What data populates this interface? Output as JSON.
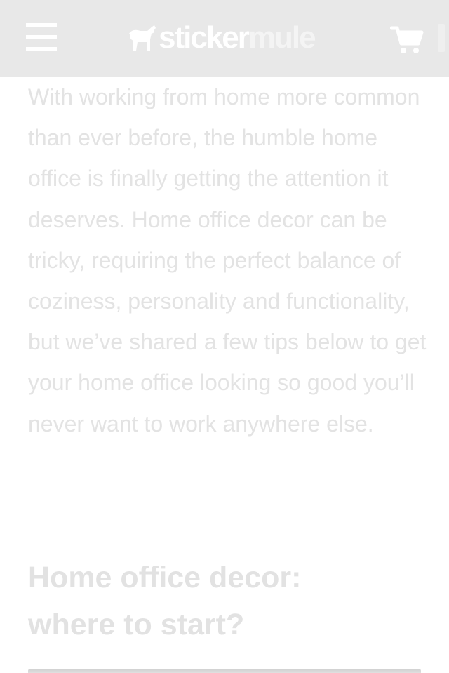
{
  "header": {
    "logo": {
      "part1": "sticker",
      "part2": "mule",
      "icon": "horse-logo-icon"
    },
    "menu_icon": "hamburger-menu-icon",
    "cart_icon": "shopping-cart-icon"
  },
  "article": {
    "intro": "With working from home more common than ever before, the humble home office is finally getting the attention it deserves. Home office decor can be tricky, requiring the perfect balance of coziness, personality and functionality, but we’ve shared a few tips below to get your home office looking so good you’ll never want to work anywhere else.",
    "heading": "Home office decor: where to start?"
  },
  "colors": {
    "header_bg": "#e8e8e8",
    "text_faded": "#e3e3e3",
    "icon": "#ffffff"
  }
}
